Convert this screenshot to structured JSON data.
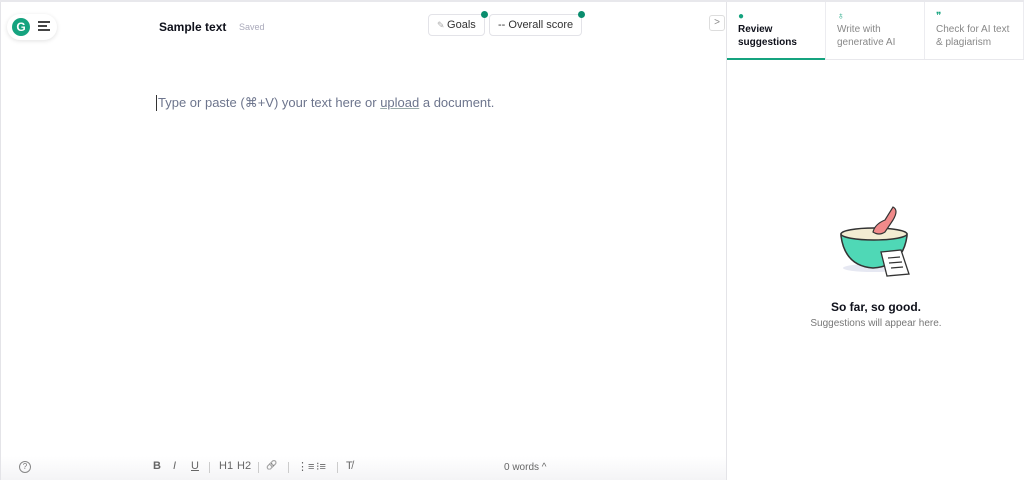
{
  "header": {
    "title": "Sample text",
    "status": "Saved",
    "goals_label": "Goals",
    "score_label": "-- Overall score"
  },
  "editor": {
    "placeholder_before": "Type or paste (⌘+V) your text here or ",
    "placeholder_link": "upload",
    "placeholder_after": " a document."
  },
  "toolbar": {
    "bold": "B",
    "italic": "I",
    "underline": "U",
    "h1": "H1",
    "h2": "H2",
    "link": "🔗",
    "ordered": "⋮≡",
    "unordered": "⁝≡",
    "clear": "T̸",
    "word_count": "0 words",
    "word_count_caret": "^",
    "help": "?"
  },
  "panel": {
    "tabs": [
      {
        "label": "Review suggestions"
      },
      {
        "label": "Write with generative AI"
      },
      {
        "label": "Check for AI text & plagiarism"
      }
    ],
    "empty_title": "So far, so good.",
    "empty_subtitle": "Suggestions will appear here."
  },
  "colors": {
    "accent": "#15a37f"
  }
}
